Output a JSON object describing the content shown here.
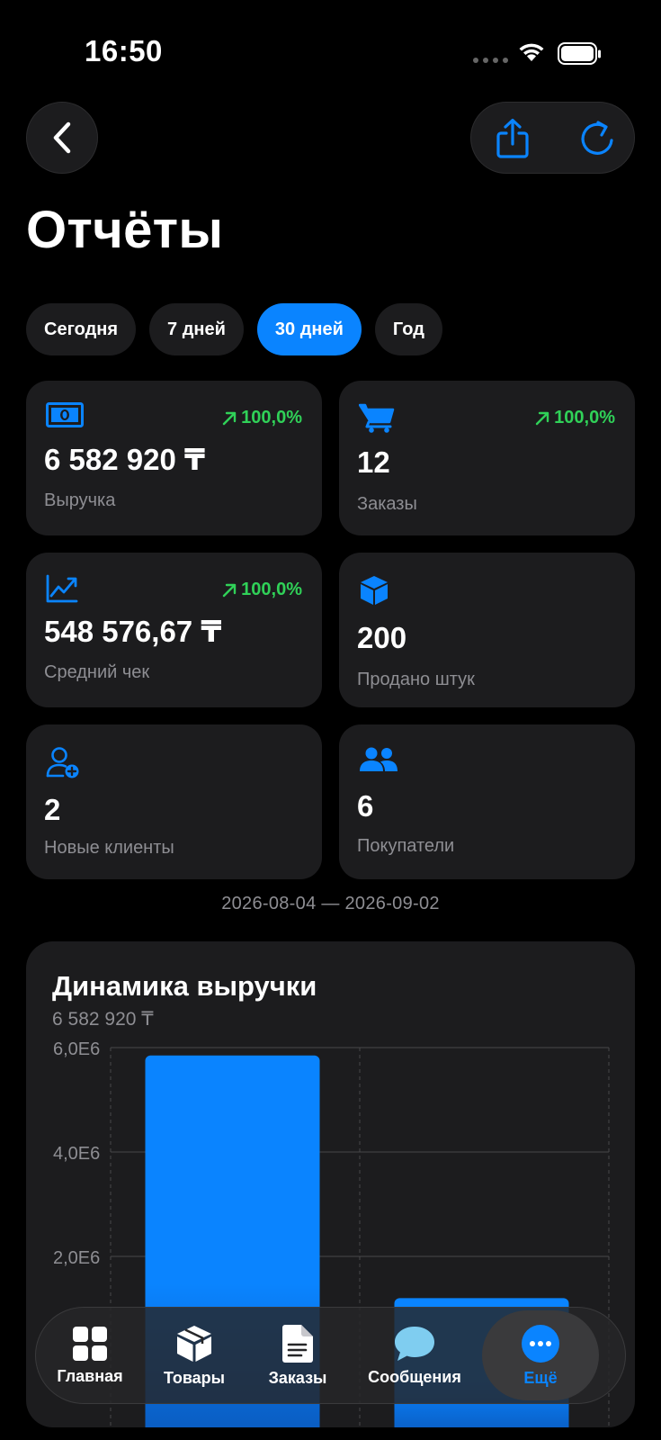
{
  "status_bar": {
    "time": "16:50"
  },
  "header": {
    "title": "Отчёты"
  },
  "periods": [
    {
      "label": "Сегодня",
      "active": false
    },
    {
      "label": "7 дней",
      "active": false
    },
    {
      "label": "30 дней",
      "active": true
    },
    {
      "label": "Год",
      "active": false
    }
  ],
  "stats": [
    {
      "icon": "banknote-icon",
      "value": "6 582 920 ₸",
      "label": "Выручка",
      "delta": "100,0%"
    },
    {
      "icon": "cart-icon",
      "value": "12",
      "label": "Заказы",
      "delta": "100,0%"
    },
    {
      "icon": "trend-chart-icon",
      "value": "548 576,67 ₸",
      "label": "Средний чек",
      "delta": "100,0%"
    },
    {
      "icon": "box-icon",
      "value": "200",
      "label": "Продано штук"
    },
    {
      "icon": "add-person-icon",
      "value": "2",
      "label": "Новые клиенты"
    },
    {
      "icon": "people-icon",
      "value": "6",
      "label": "Покупатели"
    }
  ],
  "date_range": "2026-08-04 — 2026-09-02",
  "chart": {
    "title": "Динамика выручки",
    "subtitle": "6 582 920 ₸"
  },
  "chart_data": {
    "type": "bar",
    "title": "Динамика выручки",
    "ylim": [
      0,
      6000000
    ],
    "yticks": [
      "6,0E6",
      "4,0E6",
      "2,0E6"
    ],
    "ytick_values": [
      6000000,
      4000000,
      2000000
    ],
    "series": [
      {
        "values": [
          5850000,
          1200000
        ]
      }
    ],
    "grid": true,
    "accent_color": "#0a84ff"
  },
  "tab_bar": {
    "items": [
      {
        "label": "Главная",
        "icon": "grid-icon",
        "active": false
      },
      {
        "label": "Товары",
        "icon": "box-icon",
        "active": false
      },
      {
        "label": "Заказы",
        "icon": "document-icon",
        "active": false
      },
      {
        "label": "Сообщения",
        "icon": "chat-bubble-icon",
        "active": false
      },
      {
        "label": "Ещё",
        "icon": "more-icon",
        "active": true
      }
    ]
  },
  "colors": {
    "accent": "#0a84ff",
    "positive": "#30d158",
    "card": "#1c1c1e",
    "muted": "#8e8e93"
  }
}
